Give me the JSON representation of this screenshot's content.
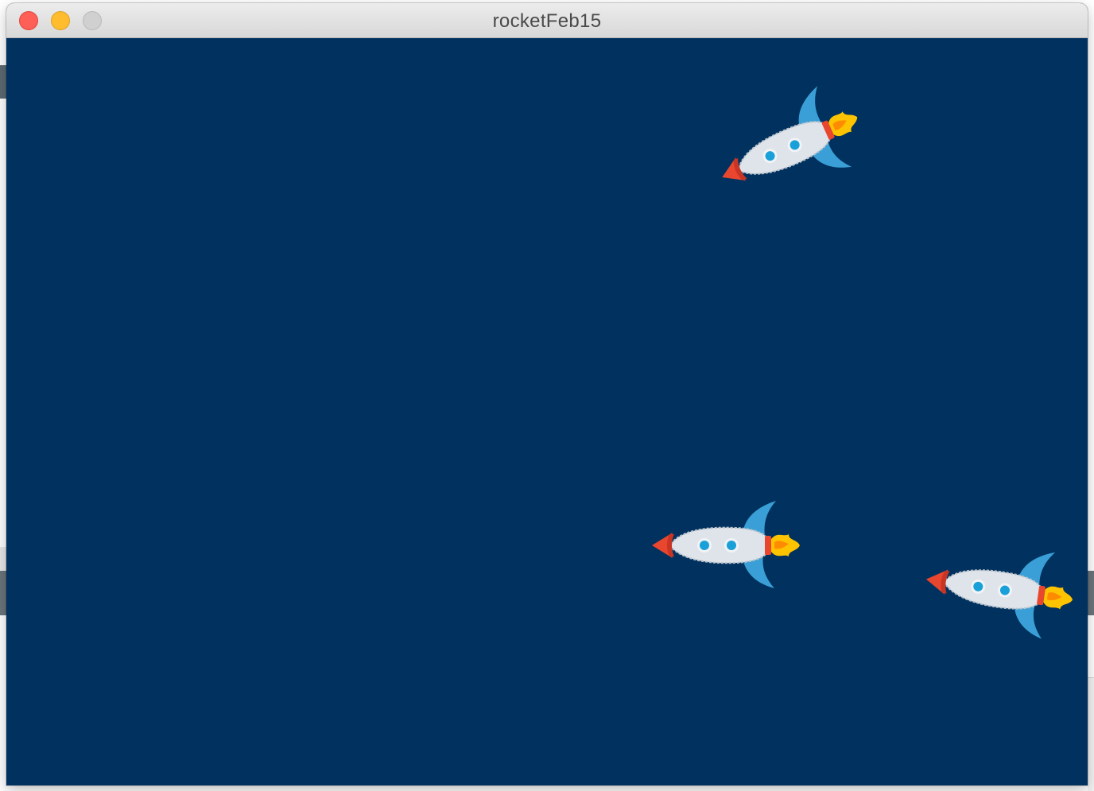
{
  "window": {
    "title": "rocketFeb15",
    "controls": {
      "close": "close-icon",
      "minimize": "minimize-icon",
      "zoom": "zoom-icon"
    }
  },
  "canvas": {
    "background": "#01325f"
  },
  "sprites": {
    "rocket": {
      "count": 3,
      "colors": {
        "body": "#dfe4ea",
        "body_outline": "#b9c2cc",
        "nose": "#e8462f",
        "fins": "#3a9fd6",
        "windows": "#1aa0d8",
        "flame": "#ffc400"
      }
    }
  }
}
